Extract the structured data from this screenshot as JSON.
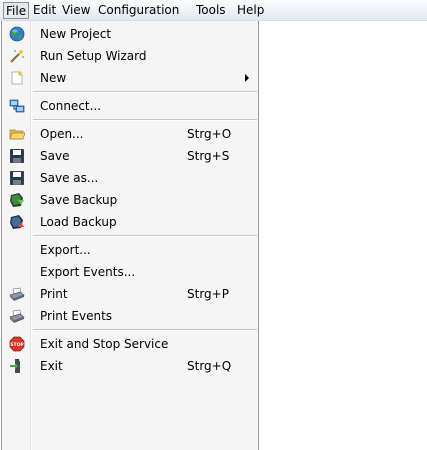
{
  "menubar": {
    "items": [
      {
        "label": "File"
      },
      {
        "label": "Edit"
      },
      {
        "label": "View"
      },
      {
        "label": "Configuration"
      },
      {
        "label": "Tools"
      },
      {
        "label": "Help"
      }
    ]
  },
  "file_menu": {
    "items": [
      {
        "label": "New Project",
        "icon": "globe-icon"
      },
      {
        "label": "Run Setup Wizard",
        "icon": "magic-wand-icon"
      },
      {
        "label": "New",
        "icon": "new-document-icon",
        "submenu": true
      },
      {
        "label": "Connect...",
        "icon": "network-connect-icon"
      },
      {
        "label": "Open...",
        "shortcut": "Strg+O",
        "icon": "open-folder-icon"
      },
      {
        "label": "Save",
        "shortcut": "Strg+S",
        "icon": "floppy-disk-icon"
      },
      {
        "label": "Save as...",
        "icon": "floppy-disk-icon"
      },
      {
        "label": "Save Backup",
        "icon": "backup-save-icon"
      },
      {
        "label": "Load Backup",
        "icon": "backup-load-icon"
      },
      {
        "label": "Export..."
      },
      {
        "label": "Export Events..."
      },
      {
        "label": "Print",
        "shortcut": "Strg+P",
        "icon": "printer-icon"
      },
      {
        "label": "Print Events",
        "icon": "printer-icon"
      },
      {
        "label": "Exit and Stop Service",
        "icon": "stop-sign-icon"
      },
      {
        "label": "Exit",
        "shortcut": "Strg+Q",
        "icon": "exit-door-icon"
      }
    ],
    "stop_icon_text": "STOP"
  }
}
